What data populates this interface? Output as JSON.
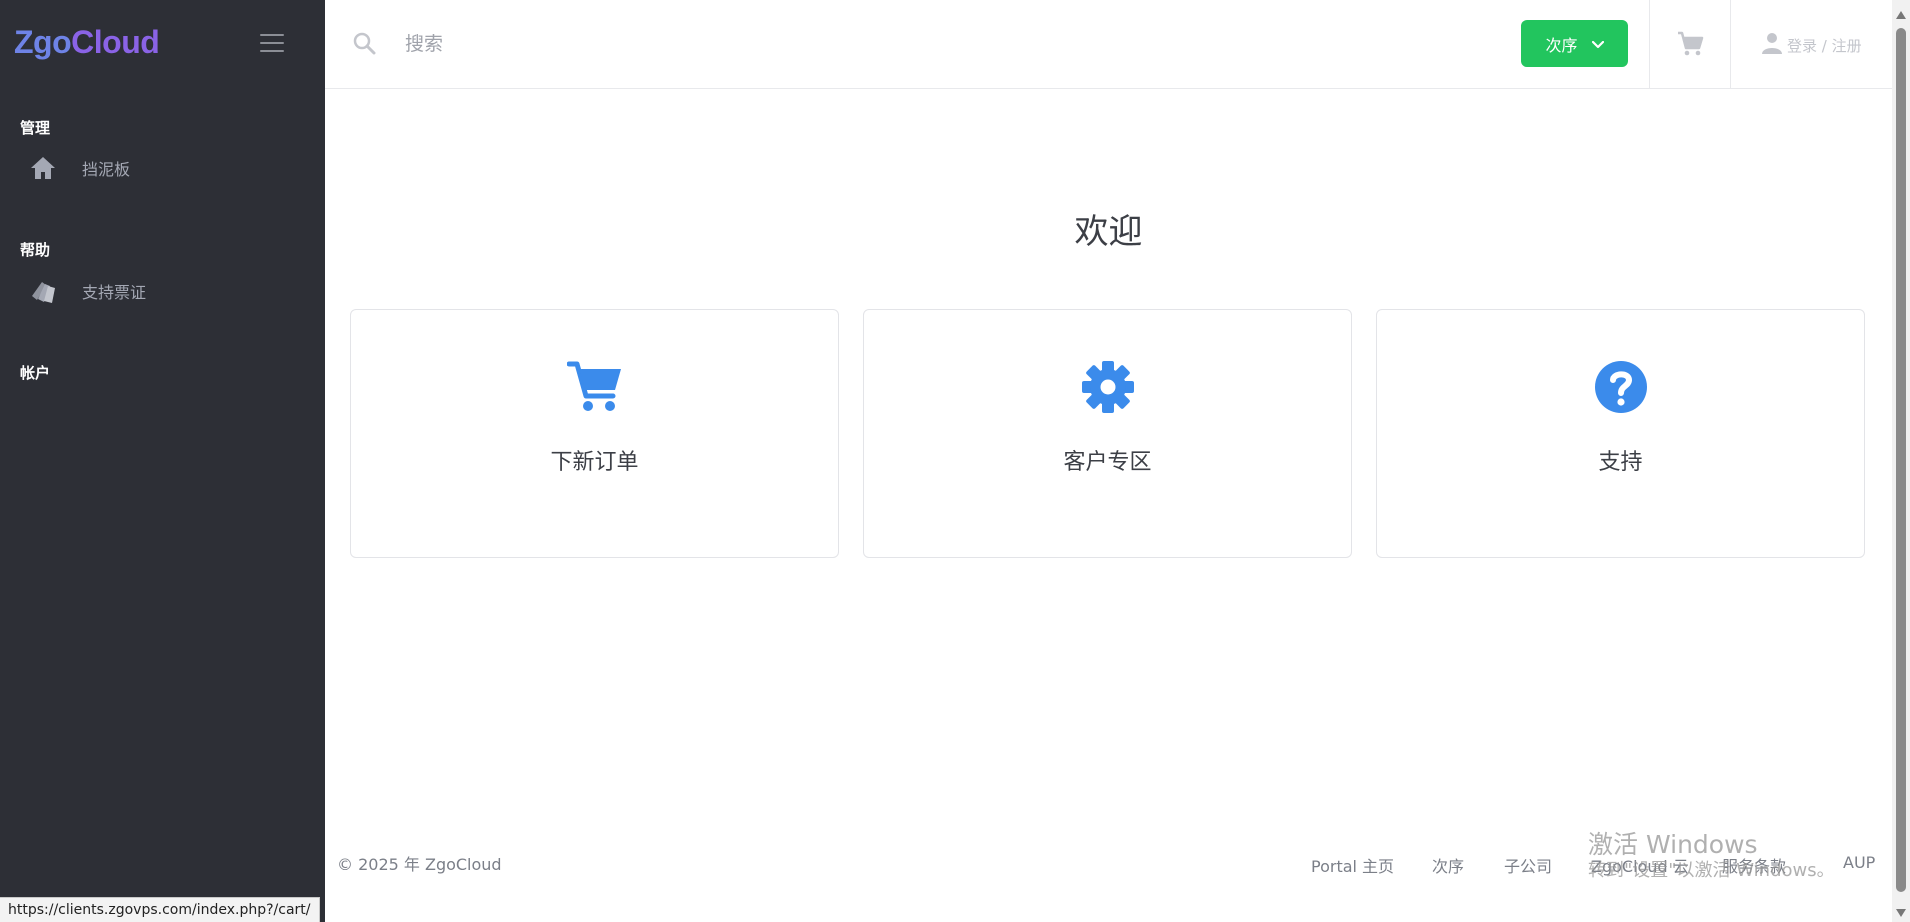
{
  "brand": {
    "part1": "Zgo",
    "part2": "Cloud"
  },
  "sidebar": {
    "sections": [
      {
        "title": "管理",
        "items": [
          {
            "label": "挡泥板",
            "icon": "home-icon"
          }
        ]
      },
      {
        "title": "帮助",
        "items": [
          {
            "label": "支持票证",
            "icon": "tickets-icon"
          }
        ]
      },
      {
        "title": "帐户",
        "items": []
      }
    ]
  },
  "header": {
    "search_placeholder": "搜索",
    "order_button": "次序",
    "login": "登录 / 注册"
  },
  "main": {
    "welcome": "欢迎",
    "cards": [
      {
        "label": "下新订单",
        "icon": "cart-icon"
      },
      {
        "label": "客户专区",
        "icon": "gear-icon"
      },
      {
        "label": "支持",
        "icon": "question-icon"
      }
    ]
  },
  "footer": {
    "copyright": "© 2025 年 ZgoCloud",
    "links": [
      "Portal 主页",
      "次序",
      "子公司",
      "ZgoCloud 云",
      "服务条款",
      "AUP"
    ]
  },
  "watermark": {
    "line1": "激活 Windows",
    "line2": "转到\"设置\"以激活 Windows。"
  },
  "status_url": "https://clients.zgovps.com/index.php?/cart/",
  "colors": {
    "sidebar_bg": "#2d2f36",
    "accent_blue": "#3b8beb",
    "order_green": "#22c55e",
    "brand_blue": "#6e83e6",
    "brand_purple": "#8a63e6"
  }
}
